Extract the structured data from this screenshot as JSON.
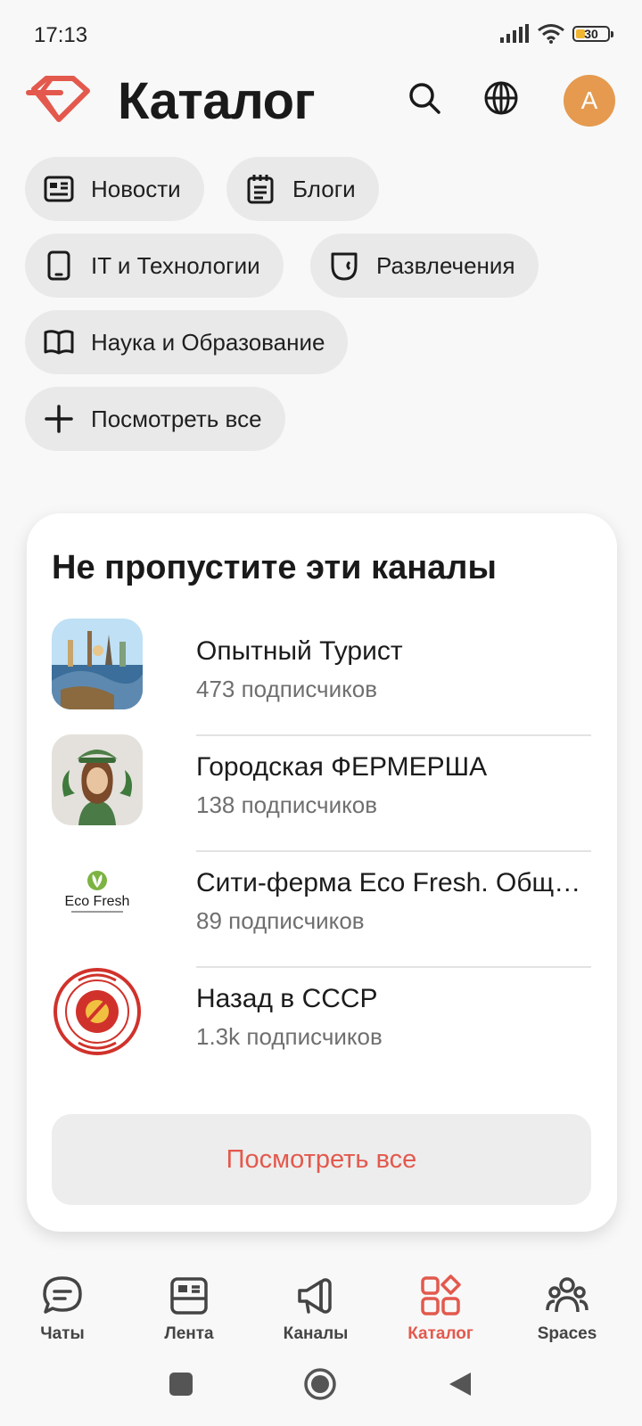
{
  "status_bar": {
    "time": "17:13",
    "battery": "30"
  },
  "header": {
    "title": "Каталог",
    "avatar_letter": "A"
  },
  "categories": [
    {
      "label": "Новости",
      "icon": "newspaper-icon"
    },
    {
      "label": "Блоги",
      "icon": "notepad-icon"
    },
    {
      "label": "IT и Технологии",
      "icon": "tablet-icon"
    },
    {
      "label": "Развлечения",
      "icon": "mask-icon"
    },
    {
      "label": "Наука и Образование",
      "icon": "book-icon"
    },
    {
      "label": "Посмотреть все",
      "icon": "plus-icon"
    }
  ],
  "card": {
    "title": "Не пропустите эти каналы",
    "channels": [
      {
        "name": "Опытный Турист",
        "subscribers": "473 подписчиков",
        "thumb": "travel-landmarks-globe"
      },
      {
        "name": "Городская ФЕРМЕРША",
        "subscribers": "138 подписчиков",
        "thumb": "farmer-girl-illustration"
      },
      {
        "name": "Сити-ферма Eco Fresh. Общ…",
        "subscribers": "89 подписчиков",
        "thumb": "eco-fresh-logo"
      },
      {
        "name": "Назад в СССР",
        "subscribers": "1.3k подписчиков",
        "thumb": "back-in-ussr-seal"
      }
    ],
    "view_all": "Посмотреть все"
  },
  "bottom_nav": [
    {
      "label": "Чаты",
      "icon": "chat-bubble-icon",
      "active": false
    },
    {
      "label": "Лента",
      "icon": "feed-icon",
      "active": false
    },
    {
      "label": "Каналы",
      "icon": "megaphone-icon",
      "active": false
    },
    {
      "label": "Каталог",
      "icon": "catalog-grid-icon",
      "active": true
    },
    {
      "label": "Spaces",
      "icon": "people-icon",
      "active": false
    }
  ],
  "colors": {
    "accent": "#e3594d",
    "avatar_bg": "#e59a4f",
    "chip_bg": "#e9e9e9",
    "page_bg": "#f8f8f8"
  }
}
